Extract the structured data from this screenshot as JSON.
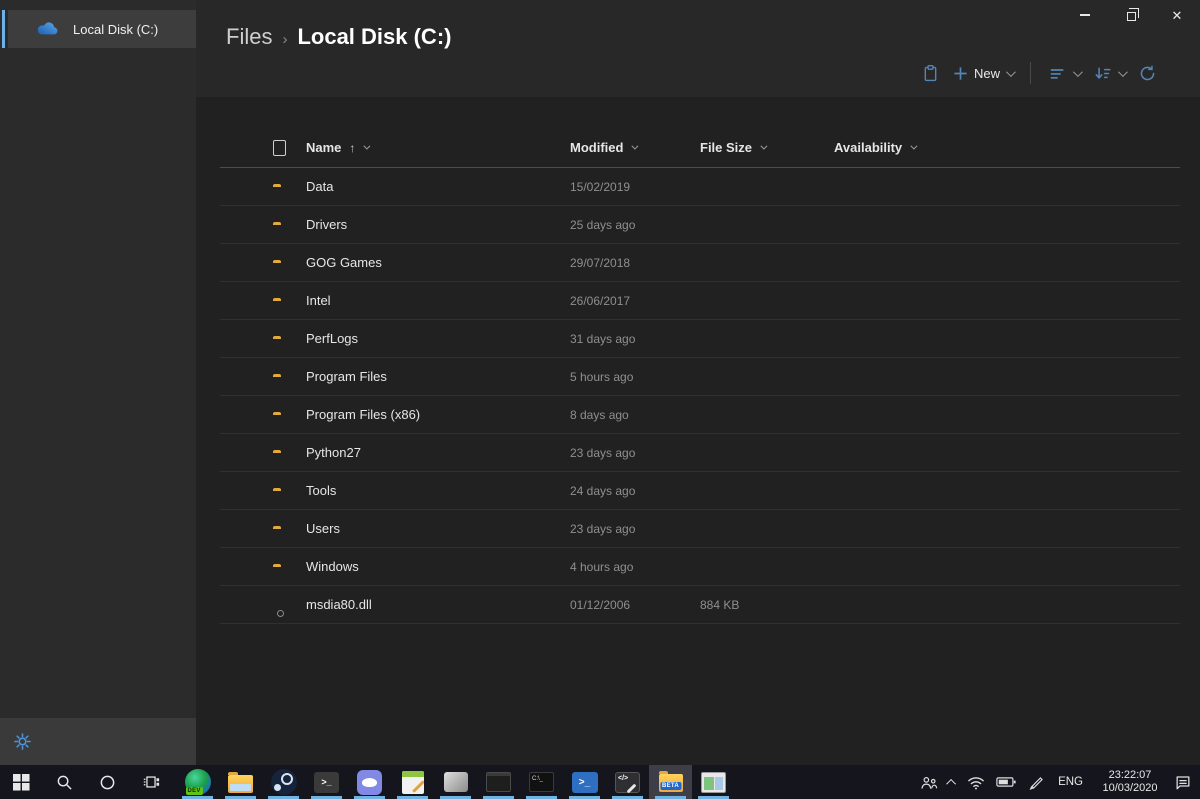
{
  "window": {
    "breadcrumb_root": "Files",
    "breadcrumb_separator": "›",
    "breadcrumb_current": "Local Disk (C:)",
    "controls": {
      "minimize": "minimize",
      "restore": "restore",
      "close": "close"
    }
  },
  "colors": {
    "accent": "#6cb2e8",
    "toolbar_icon": "#5585b5",
    "folder_yellow": "#f3b54a",
    "taskbar_bg": "#15151d",
    "sidebar_bg": "#2b2b2b"
  },
  "sidebar": {
    "items": [
      {
        "label": "Local Disk (C:)",
        "icon": "cloud-drive-icon",
        "selected": true
      }
    ]
  },
  "toolbar": {
    "new_label": "New"
  },
  "table": {
    "headers": {
      "name": "Name",
      "modified": "Modified",
      "size": "File Size",
      "availability": "Availability"
    },
    "sort": {
      "column": "Name",
      "direction": "ascending",
      "arrow": "↑"
    },
    "rows": [
      {
        "name": "Data",
        "icon": "folder",
        "modified": "15/02/2019",
        "size": "",
        "availability": ""
      },
      {
        "name": "Drivers",
        "icon": "folder",
        "modified": "25 days ago",
        "size": "",
        "availability": ""
      },
      {
        "name": "GOG Games",
        "icon": "folder",
        "modified": "29/07/2018",
        "size": "",
        "availability": ""
      },
      {
        "name": "Intel",
        "icon": "folder",
        "modified": "26/06/2017",
        "size": "",
        "availability": ""
      },
      {
        "name": "PerfLogs",
        "icon": "folder",
        "modified": "31 days ago",
        "size": "",
        "availability": ""
      },
      {
        "name": "Program Files",
        "icon": "folder",
        "modified": "5 hours ago",
        "size": "",
        "availability": ""
      },
      {
        "name": "Program Files (x86)",
        "icon": "folder",
        "modified": "8 days ago",
        "size": "",
        "availability": ""
      },
      {
        "name": "Python27",
        "icon": "folder",
        "modified": "23 days ago",
        "size": "",
        "availability": ""
      },
      {
        "name": "Tools",
        "icon": "folder",
        "modified": "24 days ago",
        "size": "",
        "availability": ""
      },
      {
        "name": "Users",
        "icon": "folder",
        "modified": "23 days ago",
        "size": "",
        "availability": ""
      },
      {
        "name": "Windows",
        "icon": "folder",
        "modified": "4 hours ago",
        "size": "",
        "availability": ""
      },
      {
        "name": "msdia80.dll",
        "icon": "dll-file",
        "modified": "01/12/2006",
        "size": "884 KB",
        "availability": ""
      }
    ]
  },
  "taskbar": {
    "apps": [
      {
        "id": "edge-dev",
        "running": true,
        "active": false,
        "badge": "DEV",
        "badge_style": "green"
      },
      {
        "id": "file-explorer",
        "running": true,
        "active": false
      },
      {
        "id": "steam",
        "running": true,
        "active": false
      },
      {
        "id": "terminal",
        "running": true,
        "active": false
      },
      {
        "id": "discord",
        "running": true,
        "active": false
      },
      {
        "id": "notes",
        "running": true,
        "active": false
      },
      {
        "id": "model-3d",
        "running": true,
        "active": false
      },
      {
        "id": "console",
        "running": true,
        "active": false
      },
      {
        "id": "cmd",
        "running": true,
        "active": false
      },
      {
        "id": "powershell",
        "running": true,
        "active": false
      },
      {
        "id": "dev-tools",
        "running": true,
        "active": false
      },
      {
        "id": "files-beta",
        "running": true,
        "active": true,
        "badge": "BETA",
        "badge_style": "blue"
      },
      {
        "id": "sandbox",
        "running": true,
        "active": false
      }
    ],
    "tray": {
      "language": "ENG",
      "time": "23:22:07",
      "date": "10/03/2020"
    }
  }
}
